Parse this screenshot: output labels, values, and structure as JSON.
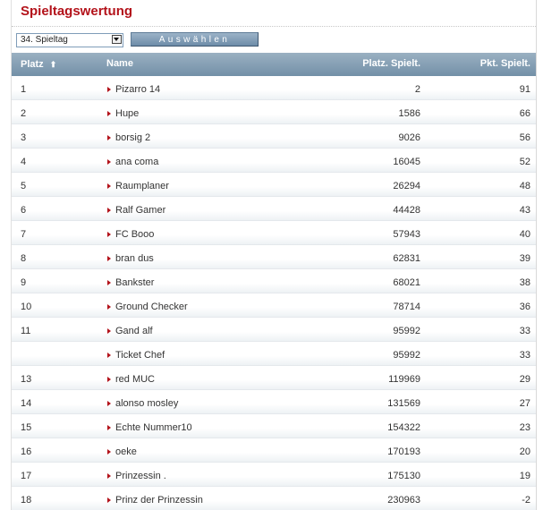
{
  "title": "Spieltagswertung",
  "selector": {
    "value": "34. Spieltag",
    "button_label": "Auswählen"
  },
  "table": {
    "headers": {
      "platz": "Platz",
      "name": "Name",
      "platz_spielt": "Platz. Spielt.",
      "pkt_spielt": "Pkt. Spielt."
    },
    "sort_icon": "⬆",
    "rows": [
      {
        "platz": "1",
        "name": "Pizarro 14",
        "platz_spielt": "2",
        "pkt_spielt": "91"
      },
      {
        "platz": "2",
        "name": "Hupe",
        "platz_spielt": "1586",
        "pkt_spielt": "66"
      },
      {
        "platz": "3",
        "name": "borsig 2",
        "platz_spielt": "9026",
        "pkt_spielt": "56"
      },
      {
        "platz": "4",
        "name": "ana coma",
        "platz_spielt": "16045",
        "pkt_spielt": "52"
      },
      {
        "platz": "5",
        "name": "Raumplaner",
        "platz_spielt": "26294",
        "pkt_spielt": "48"
      },
      {
        "platz": "6",
        "name": "Ralf Gamer",
        "platz_spielt": "44428",
        "pkt_spielt": "43"
      },
      {
        "platz": "7",
        "name": "FC Booo",
        "platz_spielt": "57943",
        "pkt_spielt": "40"
      },
      {
        "platz": "8",
        "name": "bran dus",
        "platz_spielt": "62831",
        "pkt_spielt": "39"
      },
      {
        "platz": "9",
        "name": "Bankster",
        "platz_spielt": "68021",
        "pkt_spielt": "38"
      },
      {
        "platz": "10",
        "name": "Ground Checker",
        "platz_spielt": "78714",
        "pkt_spielt": "36"
      },
      {
        "platz": "11",
        "name": "Gand alf",
        "platz_spielt": "95992",
        "pkt_spielt": "33"
      },
      {
        "platz": "",
        "name": "Ticket Chef",
        "platz_spielt": "95992",
        "pkt_spielt": "33"
      },
      {
        "platz": "13",
        "name": "red MUC",
        "platz_spielt": "119969",
        "pkt_spielt": "29"
      },
      {
        "platz": "14",
        "name": "alonso mosley",
        "platz_spielt": "131569",
        "pkt_spielt": "27"
      },
      {
        "platz": "15",
        "name": "Echte Nummer10",
        "platz_spielt": "154322",
        "pkt_spielt": "23"
      },
      {
        "platz": "16",
        "name": "oeke",
        "platz_spielt": "170193",
        "pkt_spielt": "20"
      },
      {
        "platz": "17",
        "name": "Prinzessin .",
        "platz_spielt": "175130",
        "pkt_spielt": "19"
      },
      {
        "platz": "18",
        "name": "Prinz der Prinzessin",
        "platz_spielt": "230963",
        "pkt_spielt": "-2"
      }
    ]
  }
}
